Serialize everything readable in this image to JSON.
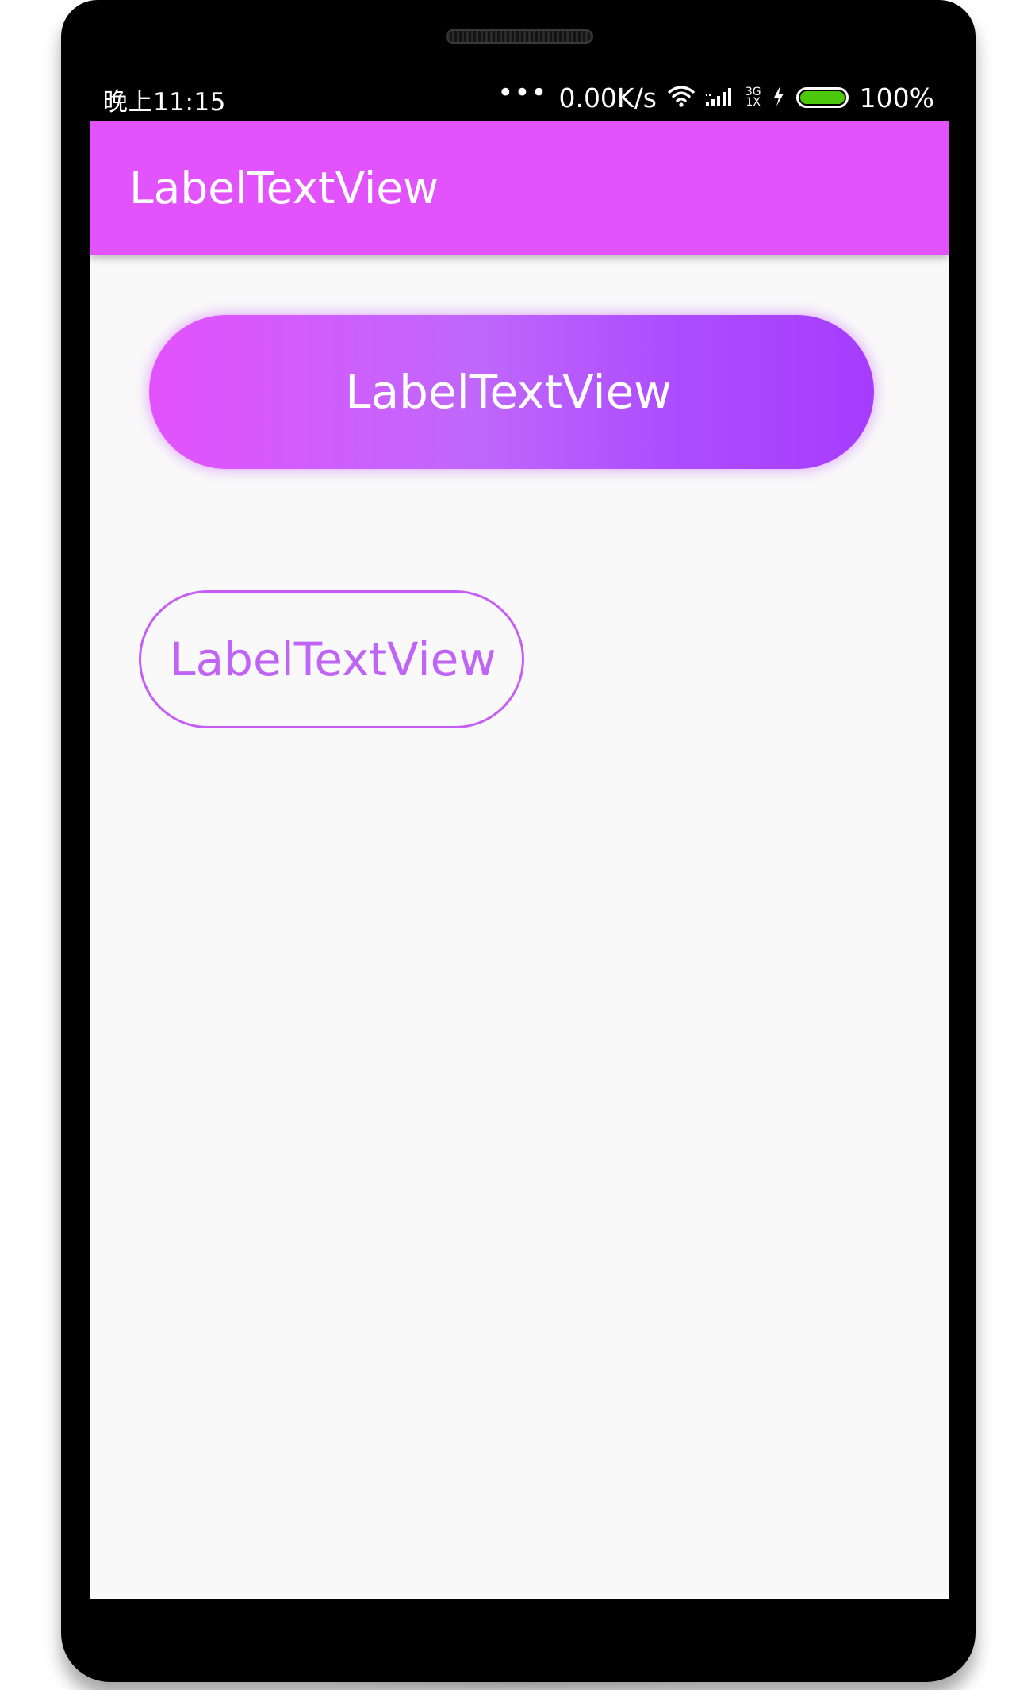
{
  "status_bar": {
    "time": "晚上11:15",
    "network_speed": "0.00K/s",
    "network_type_top": "3G",
    "network_type_bottom": "1X",
    "battery_percent_label": "100%",
    "battery_level": 1.0,
    "icons": [
      "more-dots-icon",
      "wifi-icon",
      "signal-icon",
      "charging-bolt-icon",
      "battery-icon"
    ]
  },
  "app_bar": {
    "title": "LabelTextView",
    "color": "#e252fd"
  },
  "main": {
    "gradient_button": {
      "label": "LabelTextView",
      "gradient_start": "#e252fd",
      "gradient_end": "#a63cfe"
    },
    "outline_button": {
      "label": "LabelTextView",
      "stroke_color": "#c55ef6"
    }
  }
}
